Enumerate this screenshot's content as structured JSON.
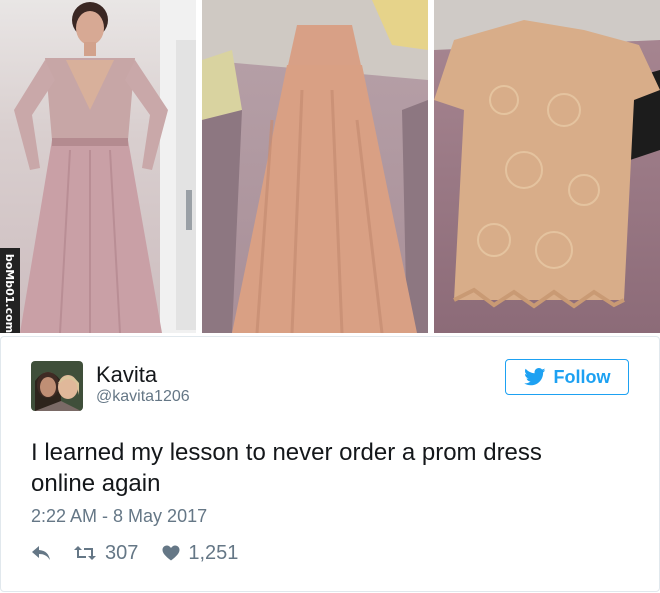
{
  "photos": {
    "watermark": "boMb01.com"
  },
  "tweet": {
    "display_name": "Kavita",
    "handle": "@kavita1206",
    "follow_label": "Follow",
    "text_line1": "I learned my lesson to never order a prom dress",
    "text_line2": "online again",
    "timestamp": "2:22 AM - 8 May 2017",
    "retweets": "307",
    "likes": "1,251"
  },
  "icons": [
    "reply-icon",
    "retweet-icon",
    "heart-icon",
    "twitter-bird-icon"
  ],
  "colors": {
    "accent": "#1da1f2",
    "muted": "#657786",
    "text": "#14171a"
  }
}
